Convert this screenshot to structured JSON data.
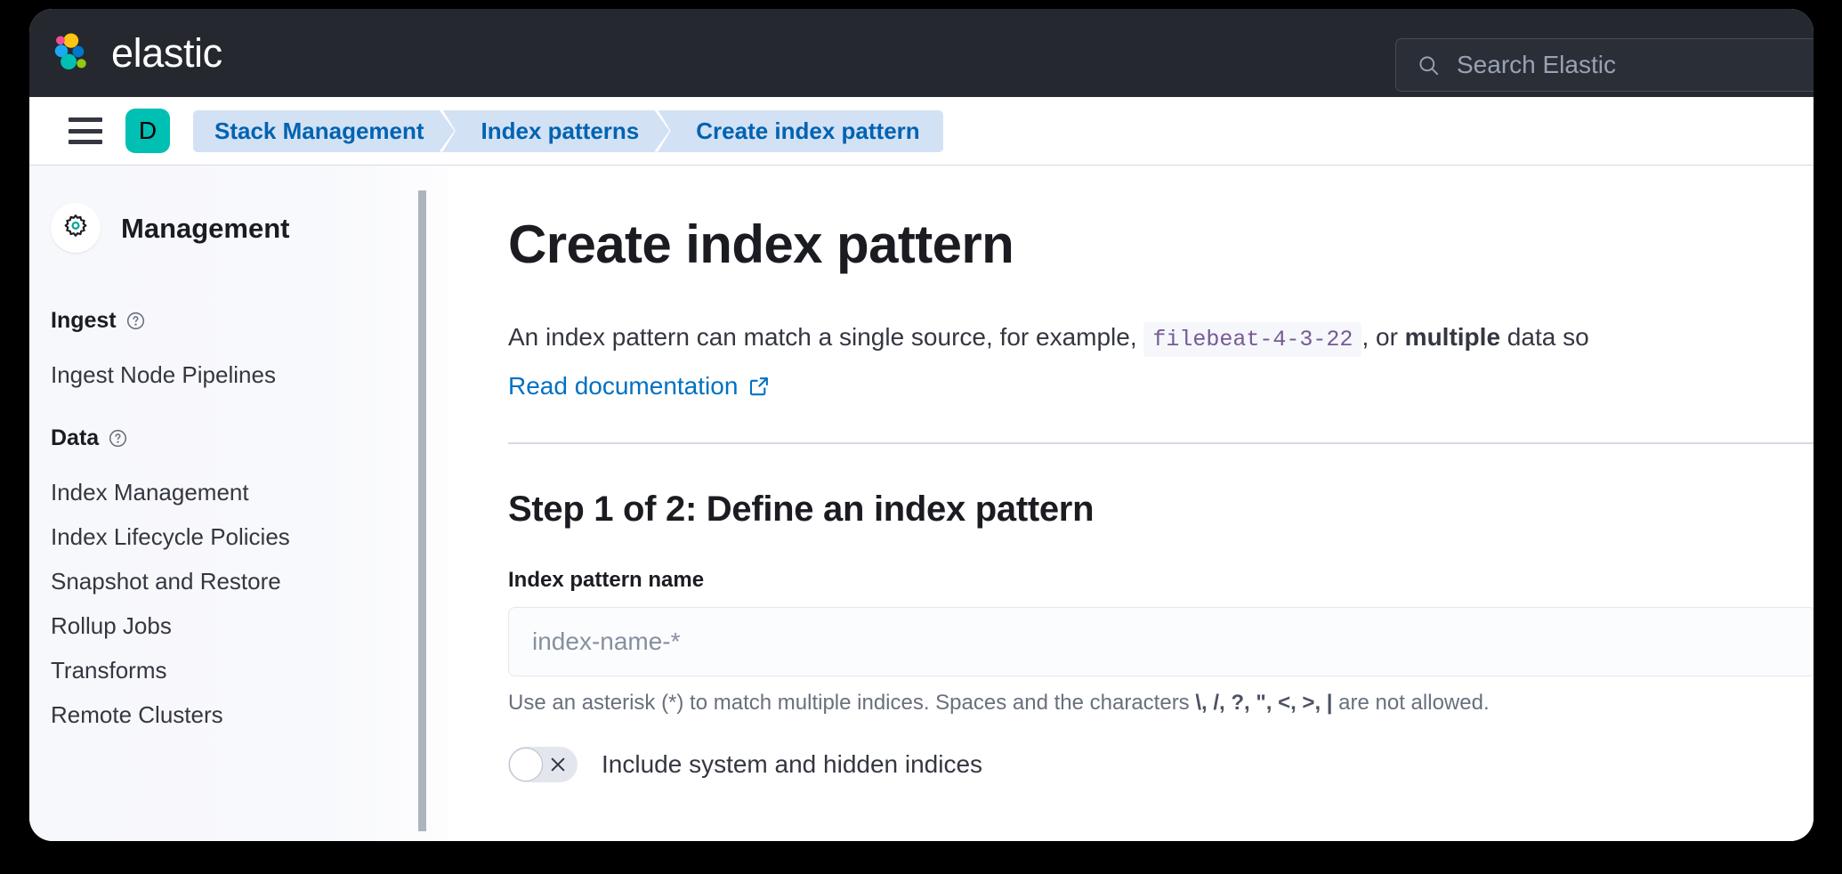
{
  "topbar": {
    "brand": "elastic",
    "logo_colors": {
      "pink": "#f04e98",
      "yellow": "#fec514",
      "blue": "#1ba9f5",
      "dark_blue": "#0077cc",
      "teal": "#00bfb3",
      "green": "#93c90e"
    },
    "search": {
      "placeholder": "Search Elastic",
      "value": "",
      "icon": "search-icon"
    },
    "background": "#25282f"
  },
  "navbar": {
    "menu_icon": "hamburger-menu-icon",
    "space": {
      "initial": "D",
      "color": "#00bfb3"
    },
    "breadcrumbs": [
      {
        "label": "Stack Management"
      },
      {
        "label": "Index patterns"
      },
      {
        "label": "Create index pattern"
      }
    ],
    "breadcrumb_bg": "#d3e1f5",
    "breadcrumb_fg": "#0063b1"
  },
  "sidebar": {
    "icon": "gear-icon",
    "title": "Management",
    "groups": [
      {
        "title": "Ingest",
        "help_icon": "question-circle-icon",
        "items": [
          {
            "label": "Ingest Node Pipelines"
          }
        ]
      },
      {
        "title": "Data",
        "help_icon": "question-circle-icon",
        "items": [
          {
            "label": "Index Management"
          },
          {
            "label": "Index Lifecycle Policies"
          },
          {
            "label": "Snapshot and Restore"
          },
          {
            "label": "Rollup Jobs"
          },
          {
            "label": "Transforms"
          },
          {
            "label": "Remote Clusters"
          }
        ]
      }
    ]
  },
  "main": {
    "page_title": "Create index pattern",
    "intro": {
      "part1": "An index pattern can match a single source, for example, ",
      "code": "filebeat-4-3-22",
      "part2": ", or ",
      "bold": "multiple",
      "part3": " data so"
    },
    "doc_link": {
      "label": "Read documentation",
      "icon": "external-link-icon",
      "color": "#0071c2"
    },
    "step": {
      "title": "Step 1 of 2: Define an index pattern",
      "field_label": "Index pattern name",
      "input_placeholder": "index-name-*",
      "input_value": "",
      "hint_part1": "Use an asterisk (*) to match multiple indices. Spaces and the characters ",
      "hint_chars": "\\, /, ?, \", <, >, |",
      "hint_part2": " are not allowed."
    },
    "toggle": {
      "label": "Include system and hidden indices",
      "state": "off",
      "icon": "cross-icon"
    }
  }
}
